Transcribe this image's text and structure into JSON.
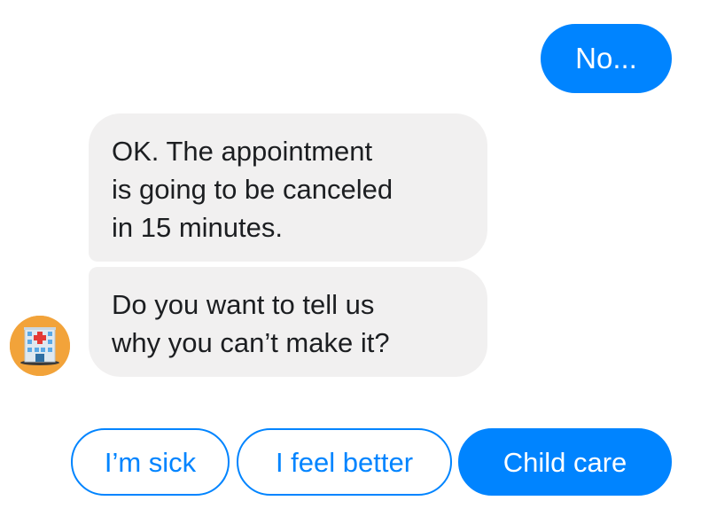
{
  "messages": [
    {
      "sender": "user",
      "text": "No..."
    },
    {
      "sender": "bot",
      "text": "OK. The appointment\nis going to be canceled\nin 15 minutes."
    },
    {
      "sender": "bot",
      "text": "Do you want to tell us\nwhy you can’t make it?"
    }
  ],
  "bot": {
    "avatar_icon": "hospital-icon",
    "avatar_color": "#f2a33a"
  },
  "quick_replies": [
    {
      "label": "I’m sick",
      "style": "outline"
    },
    {
      "label": "I feel better",
      "style": "outline"
    },
    {
      "label": "Child care",
      "style": "filled"
    }
  ],
  "colors": {
    "accent": "#0084ff",
    "bot_bubble": "#f1f0f0",
    "bot_text": "#1c1e21"
  }
}
